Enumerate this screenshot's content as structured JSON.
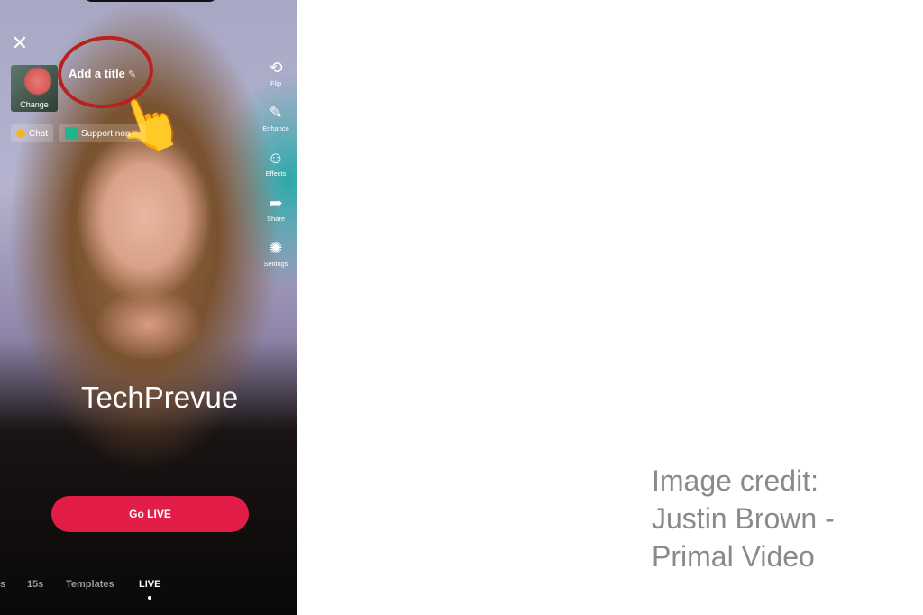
{
  "top": {
    "close_icon": "close-icon",
    "cover_label": "Change",
    "title_placeholder": "Add a title",
    "edit_icon": "pencil-icon"
  },
  "annotation": {
    "circle_color": "#b8211c",
    "pointer": "👆"
  },
  "pills": [
    {
      "label": "Chat",
      "icon": "chat-coin-icon"
    },
    {
      "label": "Support non",
      "icon": "gem-icon"
    }
  ],
  "tools": [
    {
      "label": "Flip",
      "icon": "flip-camera-icon",
      "glyph": "⟲"
    },
    {
      "label": "Enhance",
      "icon": "magic-wand-icon",
      "glyph": "✎"
    },
    {
      "label": "Effects",
      "icon": "smiley-icon",
      "glyph": "☺"
    },
    {
      "label": "Share",
      "icon": "share-arrow-icon",
      "glyph": "➦"
    },
    {
      "label": "Settings",
      "icon": "gear-icon",
      "glyph": "✺"
    }
  ],
  "watermark": "TechPrevue",
  "go_live": {
    "label": "Go LIVE",
    "color": "#e11d48"
  },
  "modes": [
    {
      "label": "s"
    },
    {
      "label": "15s"
    },
    {
      "label": "Templates"
    },
    {
      "label": "LIVE",
      "active": true
    }
  ],
  "credit": {
    "line1": "Image credit:",
    "line2": "Justin Brown -",
    "line3": "Primal Video"
  }
}
